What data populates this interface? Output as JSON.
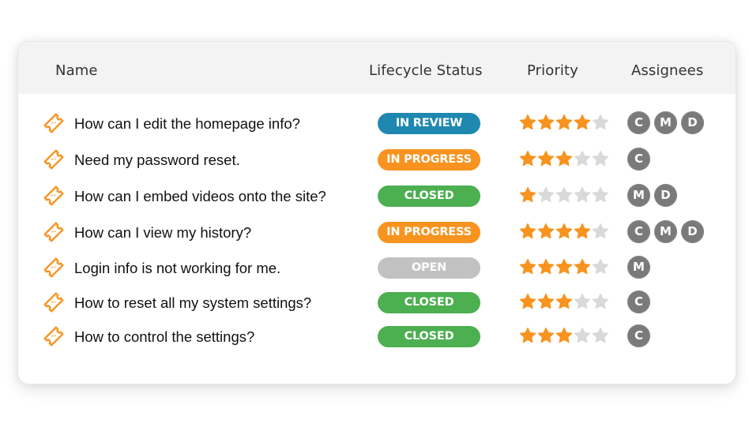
{
  "colors": {
    "in_review": "#1e88b0",
    "in_progress": "#f7931e",
    "closed": "#4caf50",
    "open": "#c2c2c2",
    "star_filled": "#f7931e",
    "star_empty": "#d9d9d9",
    "avatar": "#7a7a7a",
    "ticket_icon": "#f7931e"
  },
  "table": {
    "headers": {
      "name": "Name",
      "status": "Lifecycle Status",
      "priority": "Priority",
      "assignees": "Assignees"
    },
    "rows": [
      {
        "icon": "ticket-icon",
        "name": "How can I edit the homepage info?",
        "status": "IN REVIEW",
        "status_key": "in_review",
        "priority": 4,
        "priority_max": 5,
        "assignees": [
          "C",
          "M",
          "D"
        ]
      },
      {
        "icon": "ticket-icon",
        "name": "Need my password reset.",
        "status": "IN PROGRESS",
        "status_key": "in_progress",
        "priority": 3,
        "priority_max": 5,
        "assignees": [
          "C"
        ]
      },
      {
        "icon": "ticket-icon",
        "name": "How can I embed videos onto the site?",
        "status": "CLOSED",
        "status_key": "closed",
        "priority": 1,
        "priority_max": 5,
        "assignees": [
          "M",
          "D"
        ]
      },
      {
        "icon": "ticket-icon",
        "name": "How can I view my history?",
        "status": "IN PROGRESS",
        "status_key": "in_progress",
        "priority": 4,
        "priority_max": 5,
        "assignees": [
          "C",
          "M",
          "D"
        ]
      },
      {
        "icon": "ticket-icon",
        "name": "Login info is not working for me.",
        "status": "OPEN",
        "status_key": "open",
        "priority": 4,
        "priority_max": 5,
        "assignees": [
          "M"
        ]
      },
      {
        "icon": "ticket-icon",
        "name": "How to reset all my system settings?",
        "status": "CLOSED",
        "status_key": "closed",
        "priority": 3,
        "priority_max": 5,
        "assignees": [
          "C"
        ]
      },
      {
        "icon": "ticket-icon",
        "name": "How to control the settings?",
        "status": "CLOSED",
        "status_key": "closed",
        "priority": 3,
        "priority_max": 5,
        "assignees": [
          "C"
        ]
      }
    ]
  }
}
